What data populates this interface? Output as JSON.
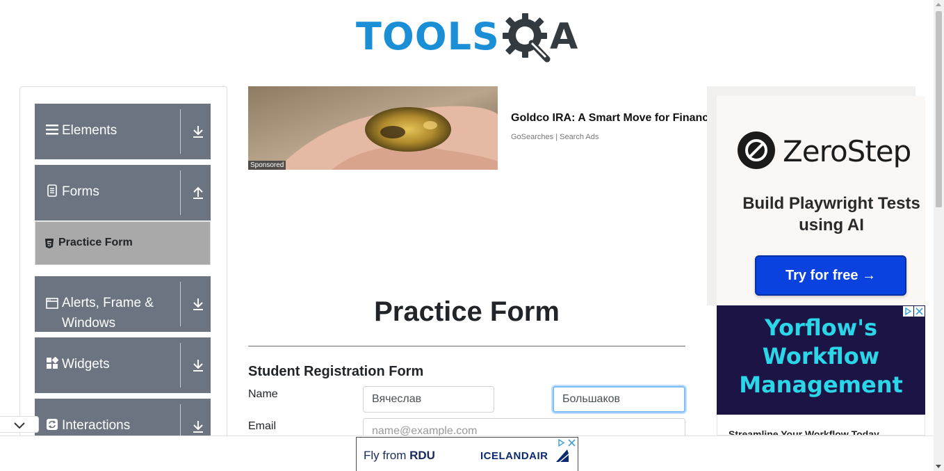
{
  "header": {
    "logo_text": "TOOLSQA",
    "logo_tools": "TOOLS",
    "logo_a": "A"
  },
  "sidebar": {
    "groups": [
      {
        "label": "Elements",
        "icon": "list-icon",
        "arrow": "download-arrow-icon"
      },
      {
        "label": "Forms",
        "icon": "document-icon",
        "arrow": "upload-arrow-icon"
      },
      {
        "label": "Alerts, Frame & Windows",
        "icon": "window-icon",
        "arrow": "download-arrow-icon"
      },
      {
        "label": "Widgets",
        "icon": "widgets-icon",
        "arrow": "download-arrow-icon"
      },
      {
        "label": "Interactions",
        "icon": "refresh-icon",
        "arrow": "download-arrow-icon"
      }
    ],
    "active_item": {
      "label": "Practice Form",
      "icon": "html5-icon"
    }
  },
  "sponsored_ad": {
    "badge": "Sponsored",
    "title": "Goldco IRA: A Smart Move for Financial",
    "source": "GoSearches | Search Ads"
  },
  "form": {
    "page_title": "Practice Form",
    "heading": "Student Registration Form",
    "name_label": "Name",
    "first_name_value": "Вячеслав",
    "last_name_value": "Большаков",
    "email_label": "Email",
    "email_placeholder": "name@example.com"
  },
  "right_ads": {
    "zerostep": {
      "brand": "ZeroStep",
      "tagline": "Build Playwright Tests using AI",
      "cta": "Try for free →"
    },
    "yorflow": {
      "headline": "Yorflow's Workflow Management",
      "clipped_text": "Streamline Your Workflow Today"
    }
  },
  "bottom_ad": {
    "text_prefix": "Fly from",
    "text_city": "RDU",
    "brand": "ICELANDAIR"
  },
  "colors": {
    "sidebar_header": "#6b7480",
    "sidebar_active": "#a9a9a9",
    "logo_blue": "#1a8fd6",
    "focus_border": "#80bdff",
    "zerostep_cta": "#0a42e0",
    "yorflow_bg": "#1c1445",
    "yorflow_text": "#2ad6e8"
  }
}
